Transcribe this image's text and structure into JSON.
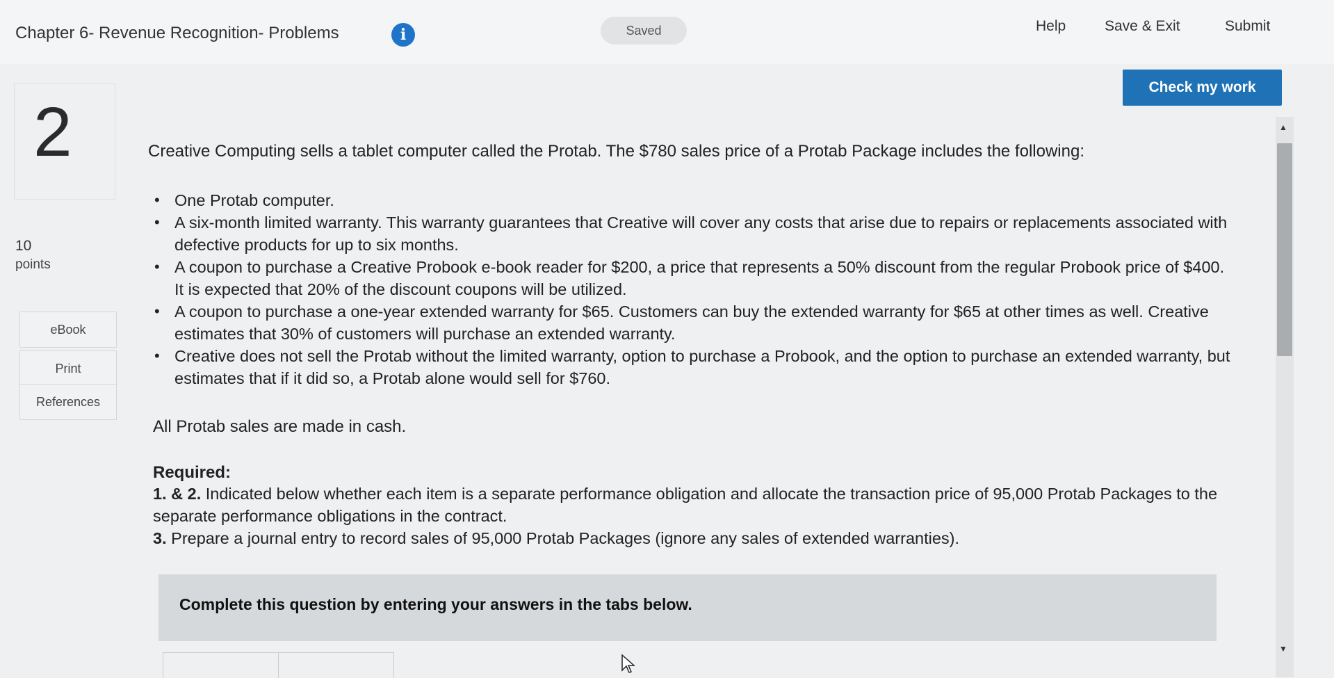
{
  "header": {
    "title": "Chapter 6- Revenue Recognition- Problems",
    "info_symbol": "i",
    "saved_label": "Saved",
    "help_label": "Help",
    "save_exit_label": "Save & Exit",
    "submit_label": "Submit",
    "check_label": "Check my work"
  },
  "sidebar": {
    "question_number": "2",
    "points_value": "10",
    "points_label": "points",
    "buttons": [
      "eBook",
      "Print",
      "References"
    ]
  },
  "question": {
    "intro": "Creative Computing sells a tablet computer called the Protab. The $780 sales price of a Protab Package includes the following:",
    "bullets": [
      "One Protab computer.",
      "A six-month limited warranty. This warranty guarantees that Creative will cover any costs that arise due to repairs or replacements associated with defective products for up to six months.",
      "A coupon to purchase a Creative Probook e-book reader for $200, a price that represents a 50% discount from the regular Probook price of $400. It is expected that 20% of the discount coupons will be utilized.",
      "A coupon to purchase a one-year extended warranty for $65. Customers can buy the extended warranty for $65 at other times as well. Creative estimates that 30% of customers will purchase an extended warranty.",
      "Creative does not sell the Protab without the limited warranty, option to purchase a Probook, and the option to purchase an extended warranty, but estimates that if it did so, a Protab alone would sell for $760."
    ],
    "cash_line": "All Protab sales are made in cash.",
    "required_heading": "Required:",
    "req1_num": "1. & 2.",
    "req1_text": "Indicated below whether each item is a separate performance obligation and allocate the transaction price of 95,000 Protab Packages to the separate performance obligations in the contract.",
    "req3_num": "3.",
    "req3_text": "Prepare a journal entry to record sales of 95,000 Protab Packages (ignore any sales of extended warranties)."
  },
  "complete_box": {
    "text": "Complete this question by entering your answers in the tabs below."
  },
  "colors": {
    "accent": "#1f72b5",
    "info_icon": "#1d74c9"
  }
}
